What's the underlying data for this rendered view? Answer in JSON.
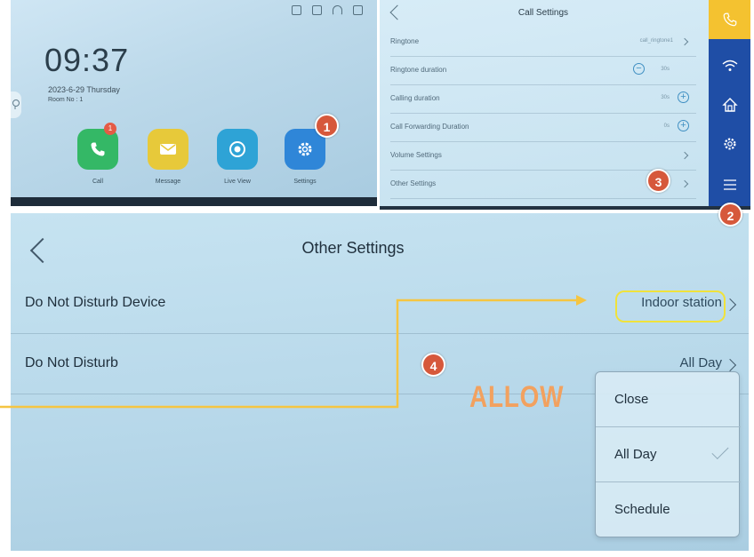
{
  "home": {
    "time": "09:37",
    "date": "2023-6-29  Thursday",
    "room": "Room No : 1",
    "call_badge": "1",
    "apps": [
      {
        "label": "Call",
        "icon": "phone-icon",
        "color": "#34b866"
      },
      {
        "label": "Message",
        "icon": "envelope-icon",
        "color": "#e7c93a"
      },
      {
        "label": "Live View",
        "icon": "camera-icon",
        "color": "#2ea3d6"
      },
      {
        "label": "Settings",
        "icon": "gear-icon",
        "color": "#2f86d8"
      }
    ]
  },
  "call_settings": {
    "title": "Call Settings",
    "rows": [
      {
        "label": "Ringtone",
        "value": "call_ringtone1"
      },
      {
        "label": "Ringtone duration",
        "value": "30s"
      },
      {
        "label": "Calling duration",
        "value": "30s"
      },
      {
        "label": "Call Forwarding Duration",
        "value": "0s"
      },
      {
        "label": "Volume Settings",
        "value": ""
      },
      {
        "label": "Other Settings",
        "value": ""
      }
    ],
    "sidebar": [
      "call-settings-icon",
      "wifi-icon",
      "home-icon",
      "gear-icon",
      "sliders-icon"
    ]
  },
  "other_settings": {
    "title": "Other Settings",
    "rows": [
      {
        "label": "Do Not Disturb Device",
        "value": "Indoor station"
      },
      {
        "label": "Do Not Disturb",
        "value": "All Day"
      }
    ],
    "dropdown": [
      "Close",
      "All Day",
      "Schedule"
    ],
    "selected": "All Day"
  },
  "annotations": {
    "steps": [
      "1",
      "2",
      "3",
      "4"
    ],
    "allow_text": "ALLOW",
    "marker_color": "#d6583b",
    "arrow_color": "#f5c542"
  }
}
